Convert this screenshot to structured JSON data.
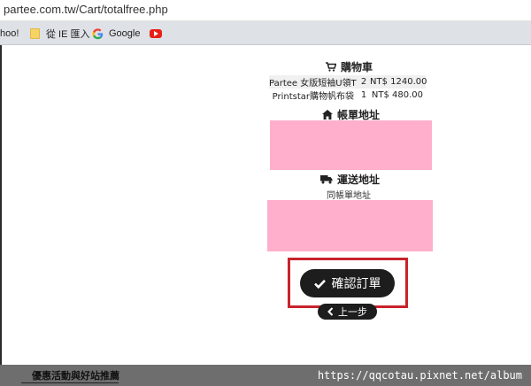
{
  "browser": {
    "url": "partee.com.tw/Cart/totalfree.php",
    "bookmarks": [
      {
        "label": "hoo!",
        "icon": "yahoo-icon"
      },
      {
        "label": "從 IE 匯入",
        "icon": "folder-icon"
      },
      {
        "label": "Google",
        "icon": "google-icon"
      },
      {
        "label": "",
        "icon": "youtube-icon"
      }
    ]
  },
  "cart": {
    "title": "購物車",
    "icon": "shopping-cart-icon",
    "items": [
      {
        "name": "Partee 女版短袖U領T",
        "qty": "2",
        "price": "NT$ 1240.00"
      },
      {
        "name": "Printstar購物帆布袋",
        "qty": "1",
        "price": "NT$ 480.00"
      }
    ]
  },
  "billing": {
    "title": "帳單地址",
    "icon": "home-icon",
    "redacted_color": "#ffafcb"
  },
  "shipping": {
    "title": "運送地址",
    "icon": "truck-icon",
    "same_as_billing": "同帳單地址",
    "redacted_color": "#ffafcb"
  },
  "actions": {
    "confirm_label": "確認訂單",
    "back_label": "上一步",
    "highlight_color": "#c8232c"
  },
  "footer": {
    "link_text": "優惠活動與好站推薦",
    "watermark": "https://qqcotau.pixnet.net/album"
  }
}
